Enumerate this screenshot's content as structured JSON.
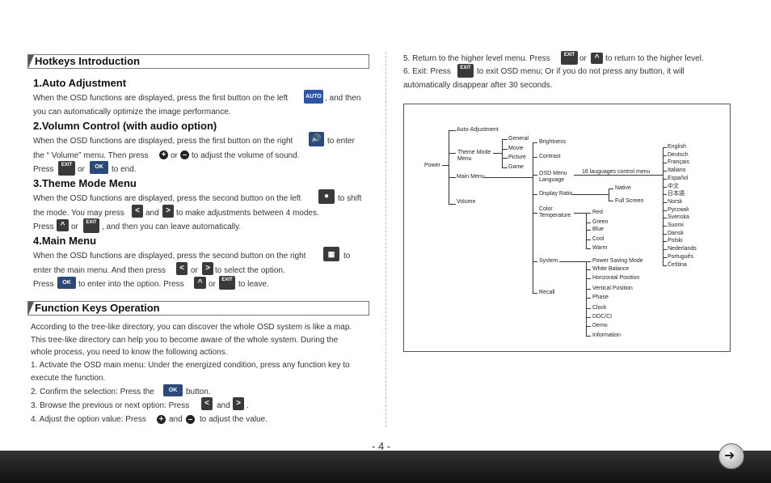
{
  "left": {
    "hotkeys_title": "Hotkeys Introduction",
    "s1_title": "1.Auto Adjustment",
    "s1_l1a": "When the OSD functions are displayed, press the first button on the left",
    "s1_l1b": ", and then",
    "s1_l2": "you can automatically optimize the image performance.",
    "s2_title": "2.Volumn Control (with audio option)",
    "s2_l1a": "When the OSD functions are displayed, press the first button on the right",
    "s2_l1b": "to enter",
    "s2_l2a": "the “ Volume” menu. Then press",
    "s2_l2b": "or",
    "s2_l2c": "to adjust the volume of sound.",
    "s2_l3a": "Press",
    "s2_l3b": "or",
    "s2_l3c": "to end.",
    "s3_title": "3.Theme Mode Menu",
    "s3_l1a": "When the OSD functions are displayed, press the second button on the left",
    "s3_l1b": "to shift",
    "s3_l2a": "the mode. You may press",
    "s3_l2b": "and",
    "s3_l2c": "to make adjustments between 4 modes.",
    "s3_l3a": "Press",
    "s3_l3b": "or",
    "s3_l3c": ", and then you can leave automatically.",
    "s4_title": "4.Main Menu",
    "s4_l1a": "When the OSD functions are displayed, press the second button on the right",
    "s4_l1b": "to",
    "s4_l2a": "enter the main menu. And then press",
    "s4_l2b": "or",
    "s4_l2c": "to select the option.",
    "s4_l3a": "Press",
    "s4_l3b": "to enter into the option. Press",
    "s4_l3c": "or",
    "s4_l3d": "to leave.",
    "func_title": "Function Keys Operation",
    "f1": "According to the tree-like directory, you can discover the whole OSD system is like a map.",
    "f2": "This tree-like directory can help you to become aware of the whole system. During the",
    "f3": "whole process, you need to know the following actions.",
    "f4": "1. Activate the OSD main menu: Under the energized condition, press any function key to",
    "f5": "execute the function.",
    "f6a": "2. Confirm the selection: Press the",
    "f6b": "button.",
    "f7a": "3. Browse the previous or next option: Press",
    "f7b": "and",
    "f7c": ".",
    "f8a": "4. Adjust the option value: Press",
    "f8b": "and",
    "f8c": "to adjust the value."
  },
  "right": {
    "r1a": "5. Return to the higher level menu. Press",
    "r1b": "or",
    "r1c": "to return to the higher level.",
    "r2a": "6. Exit: Press",
    "r2b": "to exit OSD menu; Or if you do not press any button, it will",
    "r3": "automatically disappear after 30 seconds."
  },
  "icons": {
    "auto": "AUTO",
    "ok": "OK",
    "exit": "EXIT",
    "plus": "+",
    "minus": "–"
  },
  "tree": {
    "power": "Power",
    "auto_adjustment": "Auto-Adjustment",
    "theme_mode_menu": "Theme Mode Menu",
    "main_menu": "Main Menu",
    "volume": "Volume",
    "general": "General",
    "movie": "Movie",
    "picture": "Picture",
    "game": "Game",
    "brightness": "Brightness",
    "contrast": "Contrast",
    "osd_menu_language": "OSD Menu Language",
    "display_ratio": "Display Ratio",
    "color_temperature": "Color Temperature",
    "system": "System",
    "recall": "Recall",
    "languages_control": "16 lauguages control menu",
    "native": "Native",
    "full_screen": "Full Screen",
    "red": "Red",
    "green": "Green",
    "blue": "Blue",
    "cool": "Cool",
    "warm": "Warm",
    "power_saving_mode": "Power Saving Mode",
    "white_balance": "White Balance",
    "horizontal_position": "Horizontal Position",
    "vertical_position": "Vertical Position",
    "phase": "Phase",
    "clock": "Clock",
    "ddc_ci": "DDC/CI",
    "demo": "Demo",
    "information": "Information",
    "languages": [
      "English",
      "Deutsch",
      "Français",
      "Italiano",
      "Español",
      "中文",
      "日本語",
      "Norsk",
      "Русский",
      "Svenska",
      "Suomi",
      "Dansk",
      "Polski",
      "Nederlands",
      "Português",
      "Čeština"
    ]
  },
  "footer": {
    "page_number": "- 4 -",
    "next_icon": "arrow-right-icon"
  }
}
